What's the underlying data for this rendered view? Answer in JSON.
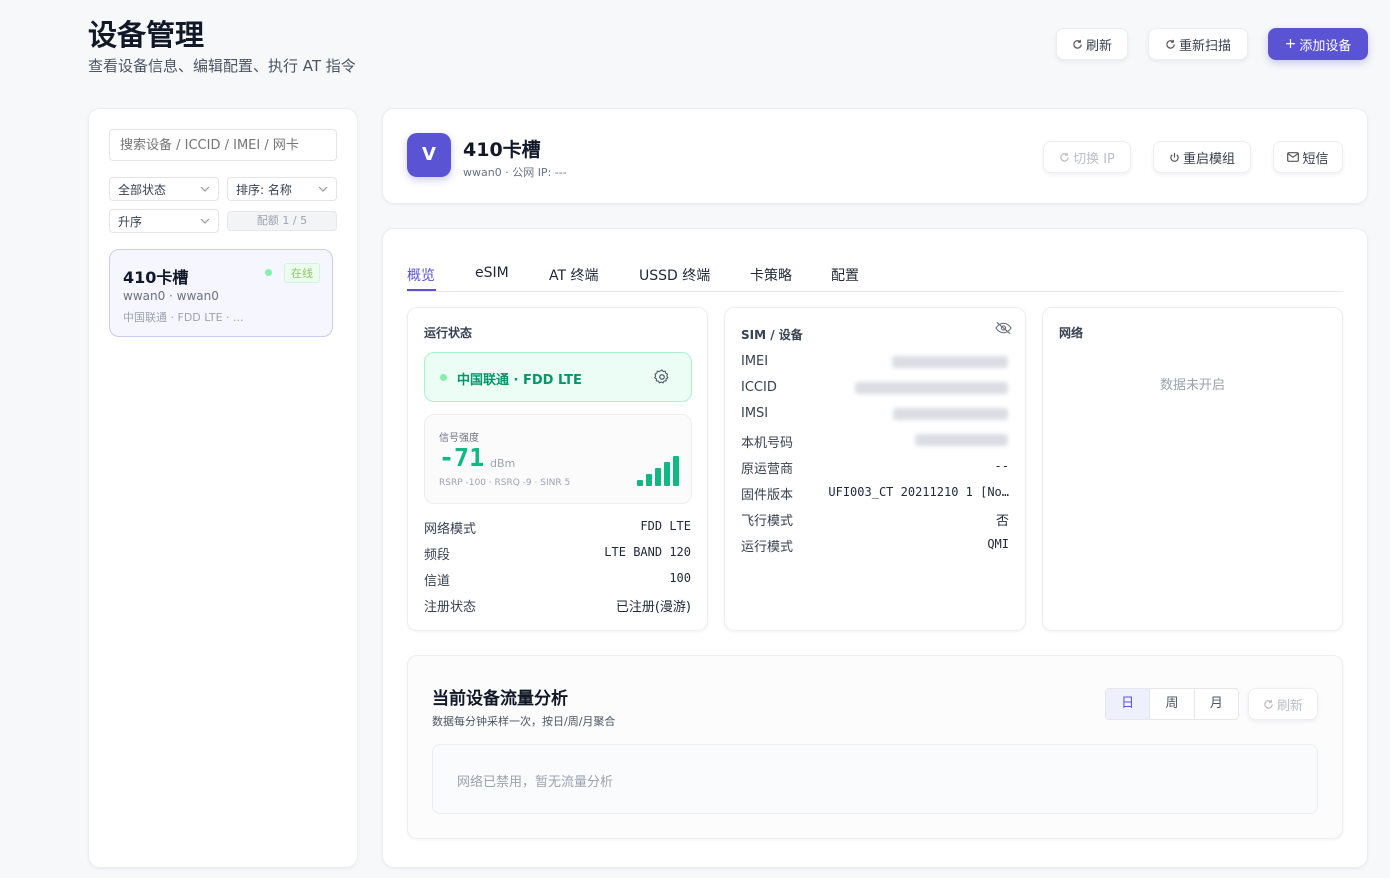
{
  "header": {
    "title": "设备管理",
    "subtitle": "查看设备信息、编辑配置、执行 AT 指令",
    "refresh_label": "刷新",
    "rescan_label": "重新扫描",
    "add_label": "添加设备"
  },
  "sidebar": {
    "search_placeholder": "搜索设备 / ICCID / IMEI / 网卡",
    "status_filter": "全部状态",
    "sort_by": "排序: 名称",
    "order": "升序",
    "quota": "配额 1 / 5",
    "devices": [
      {
        "name": "410卡槽",
        "status": "在线",
        "iface": "wwan0 · wwan0",
        "info": "中国联通 · FDD LTE · ..."
      }
    ]
  },
  "device": {
    "avatar_letter": "V",
    "name": "410卡槽",
    "meta": "wwan0 · 公网 IP: ---",
    "switch_ip_label": "切换 IP",
    "restart_label": "重启模组",
    "sms_label": "短信"
  },
  "tabs": [
    {
      "label": "概览",
      "active": true
    },
    {
      "label": "eSIM"
    },
    {
      "label": "AT 终端"
    },
    {
      "label": "USSD 终端"
    },
    {
      "label": "卡策略"
    },
    {
      "label": "配置"
    }
  ],
  "running": {
    "title": "运行状态",
    "operator_label": "中国联通 · FDD LTE",
    "signal_title": "信号强度",
    "signal_value": "-71",
    "signal_unit": "dBm",
    "signal_detail": "RSRP -100 · RSRQ -9 · SINR 5",
    "signal_bars": 5,
    "rows": [
      {
        "k": "网络模式",
        "v": "FDD LTE"
      },
      {
        "k": "频段",
        "v": "LTE BAND 120"
      },
      {
        "k": "信道",
        "v": "100"
      },
      {
        "k": "注册状态",
        "v": "已注册(漫游)"
      }
    ]
  },
  "sim": {
    "title": "SIM / 设备",
    "rows": [
      {
        "k": "IMEI",
        "v": ""
      },
      {
        "k": "ICCID",
        "v": ""
      },
      {
        "k": "IMSI",
        "v": ""
      },
      {
        "k": "本机号码",
        "v": ""
      },
      {
        "k": "原运营商",
        "v": "--"
      },
      {
        "k": "固件版本",
        "v": "UFI003_CT 20211210 1 [No…"
      },
      {
        "k": "飞行模式",
        "v": "否"
      },
      {
        "k": "运行模式",
        "v": "QMI"
      }
    ]
  },
  "network": {
    "title": "网络",
    "empty_text": "数据未开启"
  },
  "traffic": {
    "title": "当前设备流量分析",
    "subtitle": "数据每分钟采样一次，按日/周/月聚合",
    "ranges": [
      "日",
      "周",
      "月"
    ],
    "active_range": "日",
    "refresh_label": "刷新",
    "empty_text": "网络已禁用，暂无流量分析"
  },
  "colors": {
    "accent": "#5a54d4",
    "success": "#10b981",
    "success_bg": "#ecfdf5"
  }
}
